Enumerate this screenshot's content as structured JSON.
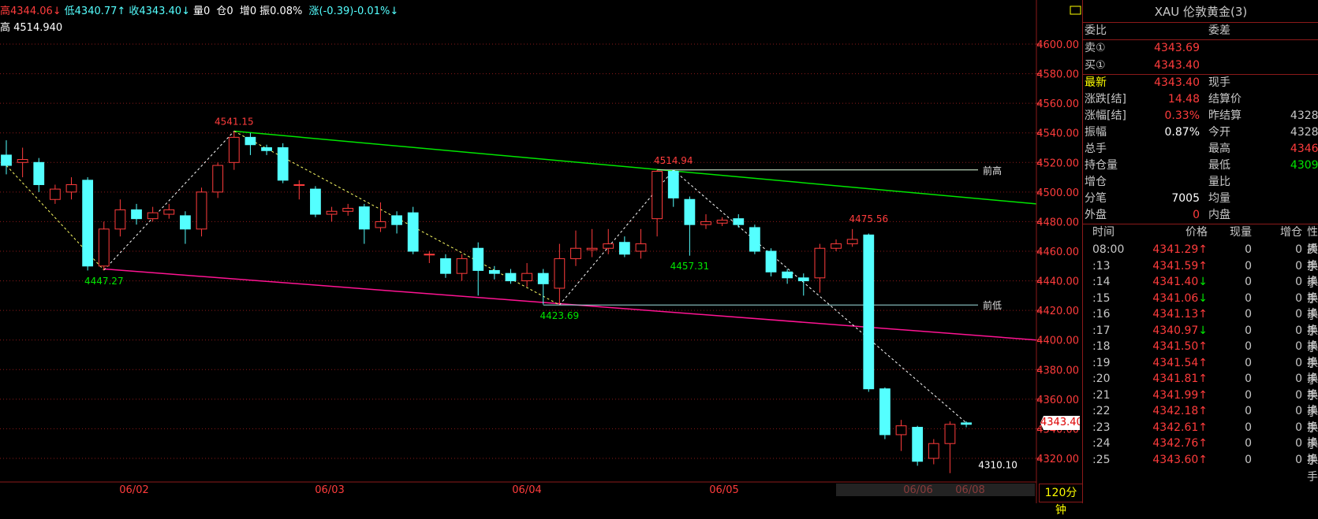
{
  "top_bar": {
    "high": "高4344.06↓",
    "low": "低4340.77↑",
    "close": "收4343.40↓",
    "volume": "量0",
    "open_interest": "仓0",
    "increase": "增0",
    "amplitude": "振0.08%",
    "change": "涨(-0.39)-0.01%↓"
  },
  "sub_bar": "高 4514.940",
  "period_label": "120分钟",
  "last_price_tag": "4343.40",
  "colors": {
    "up": "#ff3c3c",
    "down": "#54ffff",
    "upper_channel": "#00e600",
    "lower_channel": "#ff1493",
    "grid": "#8b1a1a",
    "axis_text": "#ff3c3c"
  },
  "chart_data": {
    "type": "candlestick",
    "y_axis": {
      "min": 4310,
      "max": 4610,
      "ticks": [
        4600,
        4580,
        4560,
        4540,
        4520,
        4500,
        4480,
        4460,
        4440,
        4420,
        4400,
        4380,
        4360,
        4340,
        4320
      ],
      "tick_labels": [
        "4600.00",
        "4580.00",
        "4560.00",
        "4540.00",
        "4520.00",
        "4500.00",
        "4480.00",
        "4460.00",
        "4440.00",
        "4420.00",
        "4400.00",
        "4380.00",
        "4360.00",
        "4340.00",
        "4320.00"
      ]
    },
    "x_labels": [
      "06/02",
      "06/03",
      "06/04",
      "06/05",
      "06/06",
      "06/08"
    ],
    "annotations": [
      {
        "text": "4541.15",
        "value": 4541.15,
        "color": "red",
        "at": 12
      },
      {
        "text": "4447.27",
        "value": 4447.27,
        "color": "green",
        "at": 5
      },
      {
        "text": "4514.94",
        "value": 4514.94,
        "color": "red",
        "at": 33
      },
      {
        "text": "4423.69",
        "value": 4423.69,
        "color": "green",
        "at": 27
      },
      {
        "text": "4457.31",
        "value": 4457.31,
        "color": "green",
        "at": 34
      },
      {
        "text": "4475.56",
        "value": 4475.56,
        "color": "red",
        "at": 43
      },
      {
        "text": "4310.10",
        "value": 4310.1,
        "color": "white",
        "at": 47
      }
    ],
    "reference_lines": [
      {
        "label": "前高",
        "value": 4514.94
      },
      {
        "label": "前低",
        "value": 4423.69
      }
    ],
    "candles": [
      {
        "o": 4525,
        "c": 4518,
        "h": 4535,
        "l": 4512
      },
      {
        "o": 4520,
        "c": 4522,
        "h": 4530,
        "l": 4510
      },
      {
        "o": 4520,
        "c": 4505,
        "h": 4523,
        "l": 4500
      },
      {
        "o": 4495,
        "c": 4502,
        "h": 4505,
        "l": 4492
      },
      {
        "o": 4500,
        "c": 4505,
        "h": 4510,
        "l": 4495
      },
      {
        "o": 4508,
        "c": 4450,
        "h": 4510,
        "l": 4447
      },
      {
        "o": 4450,
        "c": 4475,
        "h": 4480,
        "l": 4447
      },
      {
        "o": 4475,
        "c": 4488,
        "h": 4495,
        "l": 4470
      },
      {
        "o": 4488,
        "c": 4482,
        "h": 4492,
        "l": 4478
      },
      {
        "o": 4482,
        "c": 4486,
        "h": 4490,
        "l": 4480
      },
      {
        "o": 4485,
        "c": 4488,
        "h": 4492,
        "l": 4482
      },
      {
        "o": 4484,
        "c": 4475,
        "h": 4487,
        "l": 4465
      },
      {
        "o": 4475,
        "c": 4500,
        "h": 4503,
        "l": 4470
      },
      {
        "o": 4500,
        "c": 4518,
        "h": 4520,
        "l": 4496
      },
      {
        "o": 4520,
        "c": 4537,
        "h": 4541,
        "l": 4515
      },
      {
        "o": 4537,
        "c": 4532,
        "h": 4540,
        "l": 4525
      },
      {
        "o": 4530,
        "c": 4528,
        "h": 4532,
        "l": 4525
      },
      {
        "o": 4530,
        "c": 4508,
        "h": 4533,
        "l": 4506
      },
      {
        "o": 4505,
        "c": 4505,
        "h": 4508,
        "l": 4495
      },
      {
        "o": 4502,
        "c": 4485,
        "h": 4504,
        "l": 4483
      },
      {
        "o": 4485,
        "c": 4487,
        "h": 4490,
        "l": 4480
      },
      {
        "o": 4487,
        "c": 4489,
        "h": 4492,
        "l": 4484
      },
      {
        "o": 4490,
        "c": 4475,
        "h": 4492,
        "l": 4465
      },
      {
        "o": 4476,
        "c": 4480,
        "h": 4493,
        "l": 4473
      },
      {
        "o": 4484,
        "c": 4478,
        "h": 4487,
        "l": 4472
      },
      {
        "o": 4486,
        "c": 4460,
        "h": 4490,
        "l": 4458
      },
      {
        "o": 4458,
        "c": 4458,
        "h": 4460,
        "l": 4452
      },
      {
        "o": 4455,
        "c": 4445,
        "h": 4458,
        "l": 4442
      },
      {
        "o": 4445,
        "c": 4455,
        "h": 4458,
        "l": 4440
      },
      {
        "o": 4462,
        "c": 4447,
        "h": 4466,
        "l": 4430
      },
      {
        "o": 4447,
        "c": 4445,
        "h": 4450,
        "l": 4441
      },
      {
        "o": 4445,
        "c": 4440,
        "h": 4448,
        "l": 4438
      },
      {
        "o": 4440,
        "c": 4445,
        "h": 4452,
        "l": 4436
      },
      {
        "o": 4445,
        "c": 4438,
        "h": 4448,
        "l": 4424
      },
      {
        "o": 4435,
        "c": 4455,
        "h": 4465,
        "l": 4424
      },
      {
        "o": 4455,
        "c": 4462,
        "h": 4474,
        "l": 4450
      },
      {
        "o": 4461,
        "c": 4462,
        "h": 4475,
        "l": 4456
      },
      {
        "o": 4462,
        "c": 4465,
        "h": 4475,
        "l": 4458
      },
      {
        "o": 4466,
        "c": 4458,
        "h": 4470,
        "l": 4456
      },
      {
        "o": 4460,
        "c": 4465,
        "h": 4475,
        "l": 4455
      },
      {
        "o": 4482,
        "c": 4514,
        "h": 4515,
        "l": 4470
      },
      {
        "o": 4514,
        "c": 4496,
        "h": 4515,
        "l": 4490
      },
      {
        "o": 4495,
        "c": 4478,
        "h": 4497,
        "l": 4457
      },
      {
        "o": 4478,
        "c": 4480,
        "h": 4485,
        "l": 4475
      },
      {
        "o": 4479,
        "c": 4481,
        "h": 4483,
        "l": 4477
      },
      {
        "o": 4482,
        "c": 4478,
        "h": 4485,
        "l": 4476
      },
      {
        "o": 4476,
        "c": 4460,
        "h": 4478,
        "l": 4458
      },
      {
        "o": 4460,
        "c": 4446,
        "h": 4462,
        "l": 4443
      },
      {
        "o": 4446,
        "c": 4442,
        "h": 4448,
        "l": 4438
      },
      {
        "o": 4442,
        "c": 4440,
        "h": 4445,
        "l": 4430
      },
      {
        "o": 4442,
        "c": 4462,
        "h": 4465,
        "l": 4432
      },
      {
        "o": 4462,
        "c": 4465,
        "h": 4468,
        "l": 4460
      },
      {
        "o": 4465,
        "c": 4468,
        "h": 4475,
        "l": 4463
      },
      {
        "o": 4471,
        "c": 4367,
        "h": 4472,
        "l": 4365
      },
      {
        "o": 4367,
        "c": 4336,
        "h": 4368,
        "l": 4333
      },
      {
        "o": 4336,
        "c": 4342,
        "h": 4346,
        "l": 4325
      },
      {
        "o": 4341,
        "c": 4318,
        "h": 4342,
        "l": 4315
      },
      {
        "o": 4320,
        "c": 4330,
        "h": 4333,
        "l": 4316
      },
      {
        "o": 4330,
        "c": 4343,
        "h": 4345,
        "l": 4310
      },
      {
        "o": 4344,
        "c": 4343,
        "h": 4345,
        "l": 4341
      }
    ]
  },
  "panel": {
    "title": "XAU 伦敦黄金(3)",
    "weibi_label": "委比",
    "weicha_label": "委差",
    "sell_label": "卖①",
    "sell_value": "4343.69",
    "buy_label": "买①",
    "buy_value": "4343.40",
    "rows": [
      {
        "l": "最新",
        "v": "4343.40",
        "l2": "现手",
        "v2": ""
      },
      {
        "l": "涨跌[结]",
        "v": "14.48",
        "l2": "结算价",
        "v2": ""
      },
      {
        "l": "涨幅[结]",
        "v": "0.33%",
        "l2": "昨结算",
        "v2": "4328."
      },
      {
        "l": "振幅",
        "v": "0.87%",
        "l2": "今开",
        "v2": "4328."
      },
      {
        "l": "总手",
        "v": "",
        "l2": "最高",
        "v2": "4346."
      },
      {
        "l": "持仓量",
        "v": "",
        "l2": "最低",
        "v2": "4309."
      },
      {
        "l": "增仓",
        "v": "",
        "l2": "量比",
        "v2": ""
      },
      {
        "l": "分笔",
        "v": "7005",
        "l2": "均量",
        "v2": ""
      },
      {
        "l": "外盘",
        "v": "0",
        "l2": "内盘",
        "v2": ""
      }
    ],
    "table_headers": [
      "时间",
      "价格",
      "现量",
      "增仓",
      "性质"
    ],
    "ticks": [
      {
        "t": "08:00",
        "p": "4341.29↑",
        "q": "0",
        "i": "0",
        "n": "换手"
      },
      {
        "t": ":13",
        "p": "4341.59↑",
        "q": "0",
        "i": "0",
        "n": "换手"
      },
      {
        "t": ":14",
        "p": "4341.40↓",
        "q": "0",
        "i": "0",
        "n": "换手"
      },
      {
        "t": ":15",
        "p": "4341.06↓",
        "q": "0",
        "i": "0",
        "n": "换手"
      },
      {
        "t": ":16",
        "p": "4341.13↑",
        "q": "0",
        "i": "0",
        "n": "换手"
      },
      {
        "t": ":17",
        "p": "4340.97↓",
        "q": "0",
        "i": "0",
        "n": "换手"
      },
      {
        "t": ":18",
        "p": "4341.50↑",
        "q": "0",
        "i": "0",
        "n": "换手"
      },
      {
        "t": ":19",
        "p": "4341.54↑",
        "q": "0",
        "i": "0",
        "n": "换手"
      },
      {
        "t": ":20",
        "p": "4341.81↑",
        "q": "0",
        "i": "0",
        "n": "换手"
      },
      {
        "t": ":21",
        "p": "4341.99↑",
        "q": "0",
        "i": "0",
        "n": "换手"
      },
      {
        "t": ":22",
        "p": "4342.18↑",
        "q": "0",
        "i": "0",
        "n": "换手"
      },
      {
        "t": ":23",
        "p": "4342.61↑",
        "q": "0",
        "i": "0",
        "n": "换手"
      },
      {
        "t": ":24",
        "p": "4342.76↑",
        "q": "0",
        "i": "0",
        "n": "换手"
      },
      {
        "t": ":25",
        "p": "4343.60↑",
        "q": "0",
        "i": "0",
        "n": "换手"
      }
    ]
  }
}
